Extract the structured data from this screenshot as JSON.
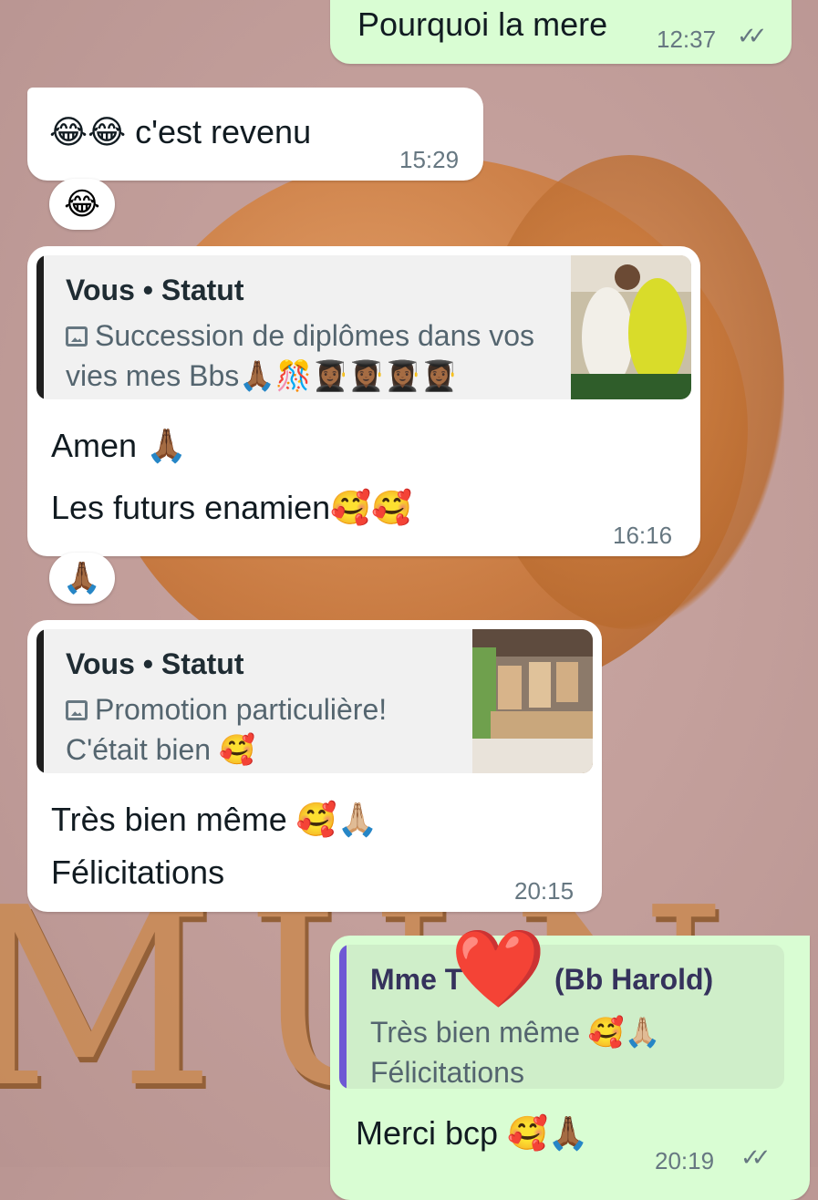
{
  "messages": [
    {
      "text": "Pourquoi la mere",
      "time": "12:37",
      "status": "✓✓"
    },
    {
      "text": "😂😂 c'est revenu",
      "time": "15:29",
      "reaction": "😂"
    },
    {
      "quote": {
        "author": "Vous • Statut",
        "text": "Succession de diplômes dans vos vies mes Bbs🙏🏾🎊👩🏾‍🎓👩🏾‍🎓👩🏾‍🎓👩🏾‍🎓"
      },
      "lines": [
        "Amen 🙏🏾",
        "Les futurs enamien🥰🥰"
      ],
      "time": "16:16",
      "reaction": "🙏🏾"
    },
    {
      "quote": {
        "author": "Vous • Statut",
        "text_line1": "Promotion particulière!",
        "text_line2": "C'était bien 🥰"
      },
      "lines": [
        "Très bien même 🥰🙏🏼",
        "Félicitations"
      ],
      "time": "20:15"
    },
    {
      "quote": {
        "author_left": "Mme T",
        "author_right": "(Bb Harold)",
        "text_line1": "Très bien même 🥰🙏🏼",
        "text_line2": "Félicitations"
      },
      "text": "Merci bcp 🥰🙏🏾",
      "time": "20:19",
      "status": "✓✓",
      "sticker": "❤️"
    }
  ],
  "colors": {
    "incoming": "#ffffff",
    "outgoing": "#d9fdd3",
    "reply_accent": "#6e58d4",
    "quote_bar": "#1f1f1f"
  }
}
